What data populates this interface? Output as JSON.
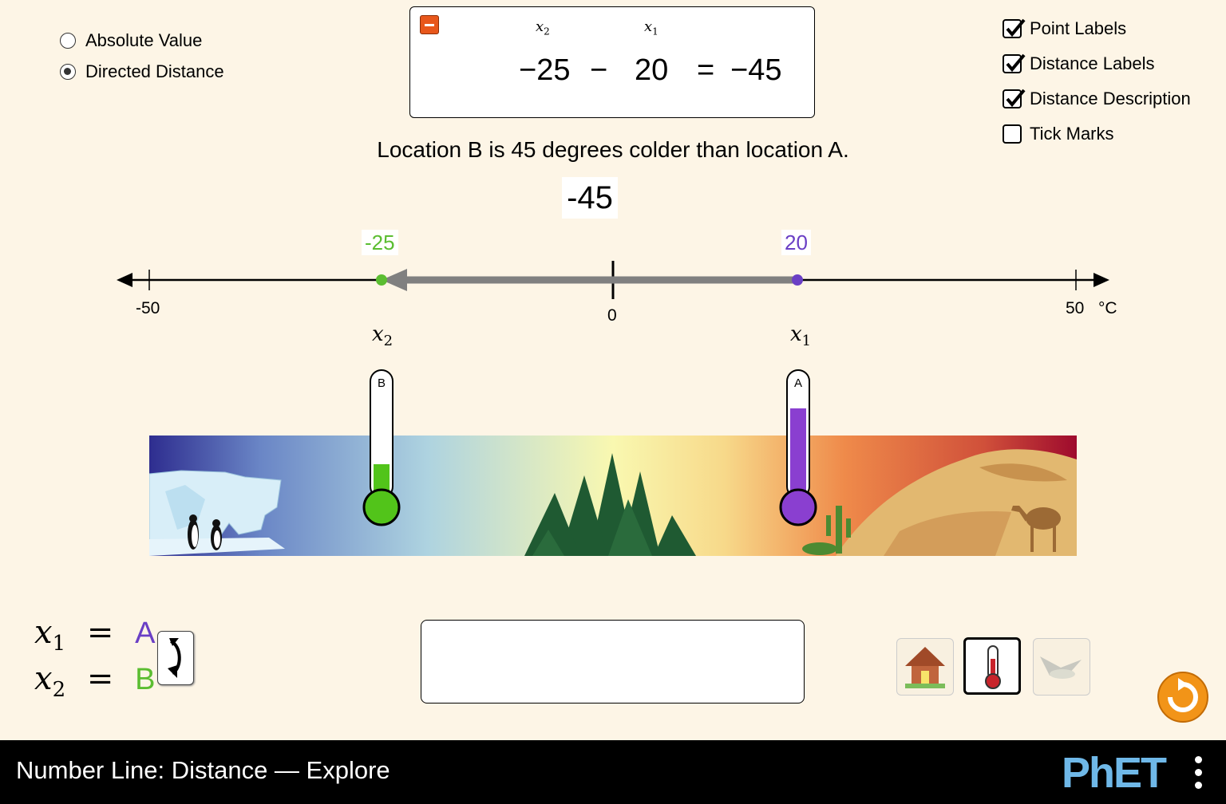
{
  "mode_radios": [
    {
      "label": "Absolute Value",
      "selected": false
    },
    {
      "label": "Directed Distance",
      "selected": true
    }
  ],
  "checkboxes": [
    {
      "label": "Point Labels",
      "checked": true
    },
    {
      "label": "Distance Labels",
      "checked": true
    },
    {
      "label": "Distance Description",
      "checked": true
    },
    {
      "label": "Tick Marks",
      "checked": false
    }
  ],
  "equation": {
    "x2_symbol": "x",
    "x2_sub": "2",
    "x1_symbol": "x",
    "x1_sub": "1",
    "x2_value": "−25",
    "operator": "−",
    "x1_value": "20",
    "equals": "=",
    "result": "−45"
  },
  "description": "Location B is 45 degrees colder than location A.",
  "distance_label": "-45",
  "number_line": {
    "min": -50,
    "max": 50,
    "min_label": "-50",
    "max_label": "50",
    "zero_label": "0",
    "unit": "°C",
    "point_a": {
      "value": 20,
      "label": "20",
      "color": "#6a3fc5"
    },
    "point_b": {
      "value": -25,
      "label": "-25",
      "color": "#5bbd31"
    }
  },
  "point_vars": {
    "x2": "x",
    "x2_sub": "2",
    "x1": "x",
    "x1_sub": "1"
  },
  "thermometers": [
    {
      "letter": "B",
      "fill_fraction": 0.25,
      "color": "#52c41a"
    },
    {
      "letter": "A",
      "fill_fraction": 0.7,
      "color": "#8a3fd0"
    }
  ],
  "assignments": {
    "x1_symbol": "x",
    "x1_sub": "1",
    "x1_equals": "=",
    "x1_value": "A",
    "x1_color": "#6a3fc5",
    "x2_symbol": "x",
    "x2_sub": "2",
    "x2_equals": "=",
    "x2_value": "B",
    "x2_color": "#5bbd31"
  },
  "scene_buttons": [
    {
      "icon": "house-icon",
      "selected": false
    },
    {
      "icon": "thermometer-icon",
      "selected": true
    },
    {
      "icon": "bird-icon",
      "selected": false
    }
  ],
  "footer": {
    "title": "Number Line: Distance — Explore",
    "logo": "PhET"
  }
}
